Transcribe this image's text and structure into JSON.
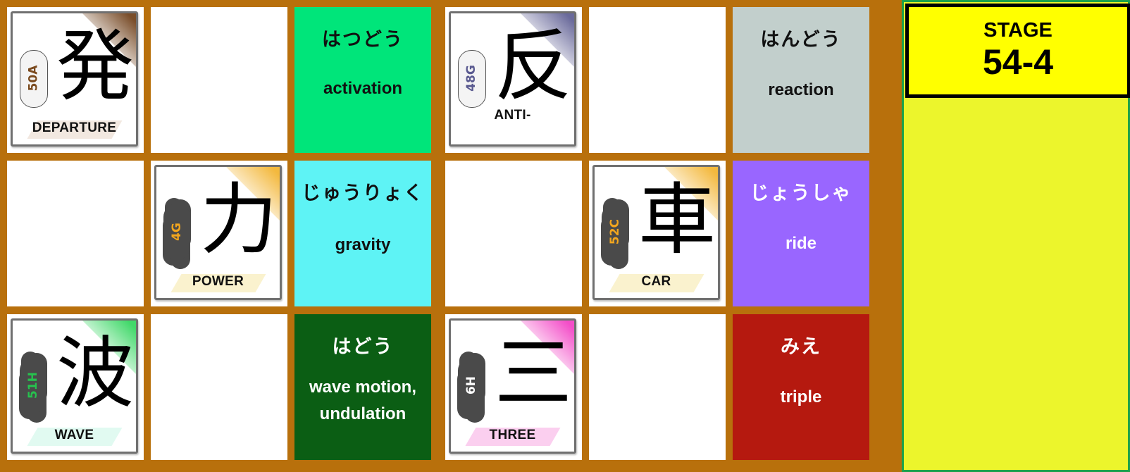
{
  "stage": {
    "label": "STAGE",
    "number": "54-4"
  },
  "kanji_cards": [
    {
      "kanji": "発",
      "code": "50A",
      "meaning": "DEPARTURE",
      "accent": "#6b3a12",
      "cloud": "light",
      "code_color": "#7a4a1e"
    },
    {
      "kanji": "反",
      "code": "48G",
      "meaning": "ANTI-",
      "accent": "#5a5a90",
      "cloud": "light",
      "code_color": "#5a5a90"
    },
    {
      "kanji": "力",
      "code": "4G",
      "meaning": "POWER",
      "accent": "#f2b128",
      "cloud": "dark",
      "code_color": "#f2a61e"
    },
    {
      "kanji": "車",
      "code": "52C",
      "meaning": "CAR",
      "accent": "#f2b128",
      "cloud": "dark",
      "code_color": "#f2a61e"
    },
    {
      "kanji": "波",
      "code": "51H",
      "meaning": "WAVE",
      "accent": "#2dd45a",
      "cloud": "dark",
      "code_color": "#26c24e"
    },
    {
      "kanji": "三",
      "code": "6H",
      "meaning": "THREE",
      "accent": "#f23ac2",
      "cloud": "dark",
      "code_color": "#ffffff"
    }
  ],
  "word_cards": [
    {
      "kana": "はつどう",
      "english": [
        "activation"
      ],
      "bg": "#00e57a",
      "fg": "#111111"
    },
    {
      "kana": "はんどう",
      "english": [
        "reaction"
      ],
      "bg": "#c2cfcc",
      "fg": "#111111"
    },
    {
      "kana": "じゅうりょく",
      "english": [
        "gravity"
      ],
      "bg": "#5ef3f5",
      "fg": "#111111"
    },
    {
      "kana": "じょうしゃ",
      "english": [
        "ride"
      ],
      "bg": "#9966ff",
      "fg": "#ffffff"
    },
    {
      "kana": "はどう",
      "english": [
        "wave motion,",
        "undulation"
      ],
      "bg": "#0b5e14",
      "fg": "#ffffff"
    },
    {
      "kana": "みえ",
      "english": [
        "triple"
      ],
      "bg": "#b5190f",
      "fg": "#ffffff"
    }
  ]
}
